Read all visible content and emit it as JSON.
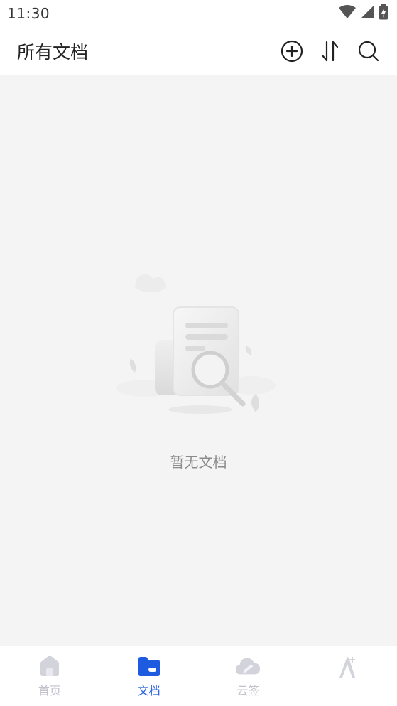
{
  "status_bar": {
    "time": "11:30"
  },
  "header": {
    "title": "所有文档",
    "actions": [
      {
        "icon": "add-circle-icon"
      },
      {
        "icon": "sort-icon"
      },
      {
        "icon": "search-icon"
      }
    ]
  },
  "empty_state": {
    "message": "暂无文档",
    "illustration": "document-search-icon"
  },
  "bottom_nav": {
    "items": [
      {
        "label": "首页",
        "icon": "home-icon",
        "active": false
      },
      {
        "label": "文档",
        "icon": "folder-icon",
        "active": true
      },
      {
        "label": "云签",
        "icon": "cloud-sign-icon",
        "active": false
      },
      {
        "label": "",
        "icon": "profile-icon",
        "active": false
      }
    ]
  },
  "colors": {
    "accent": "#1f5be0",
    "inactive": "#c2c2cc",
    "background": "#f4f4f4",
    "empty_text": "#8a8a8a"
  }
}
